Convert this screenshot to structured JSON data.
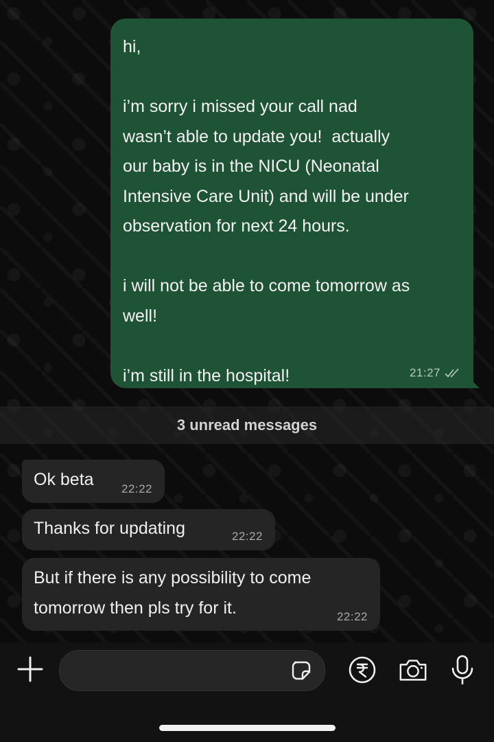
{
  "outgoing_message": {
    "text": "hi,\n\ni’m sorry i missed your call nad\nwasn’t able to update you!  actually\nour baby is in the NICU (Neonatal\nIntensive Care Unit) and will be under\nobservation for next 24 hours.\n\ni will not be able to come tomorrow as\nwell!\n\ni’m still in the hospital!",
    "time": "21:27",
    "status_icon": "double-check-read-icon"
  },
  "unread_divider": "3 unread messages",
  "incoming_messages": [
    {
      "text": "Ok beta",
      "time": "22:22"
    },
    {
      "text": "Thanks for updating",
      "time": "22:22"
    },
    {
      "text": "But if there is any possibility to come\ntomorrow then pls try for it.",
      "time": "22:22"
    }
  ],
  "composer": {
    "placeholder": "",
    "icons": [
      "plus-icon",
      "sticker-icon",
      "rupee-payment-icon",
      "camera-icon",
      "microphone-icon"
    ]
  },
  "colors": {
    "outgoing_bubble": "#1f5335",
    "incoming_bubble": "#252525",
    "background": "#0c0c0c"
  }
}
